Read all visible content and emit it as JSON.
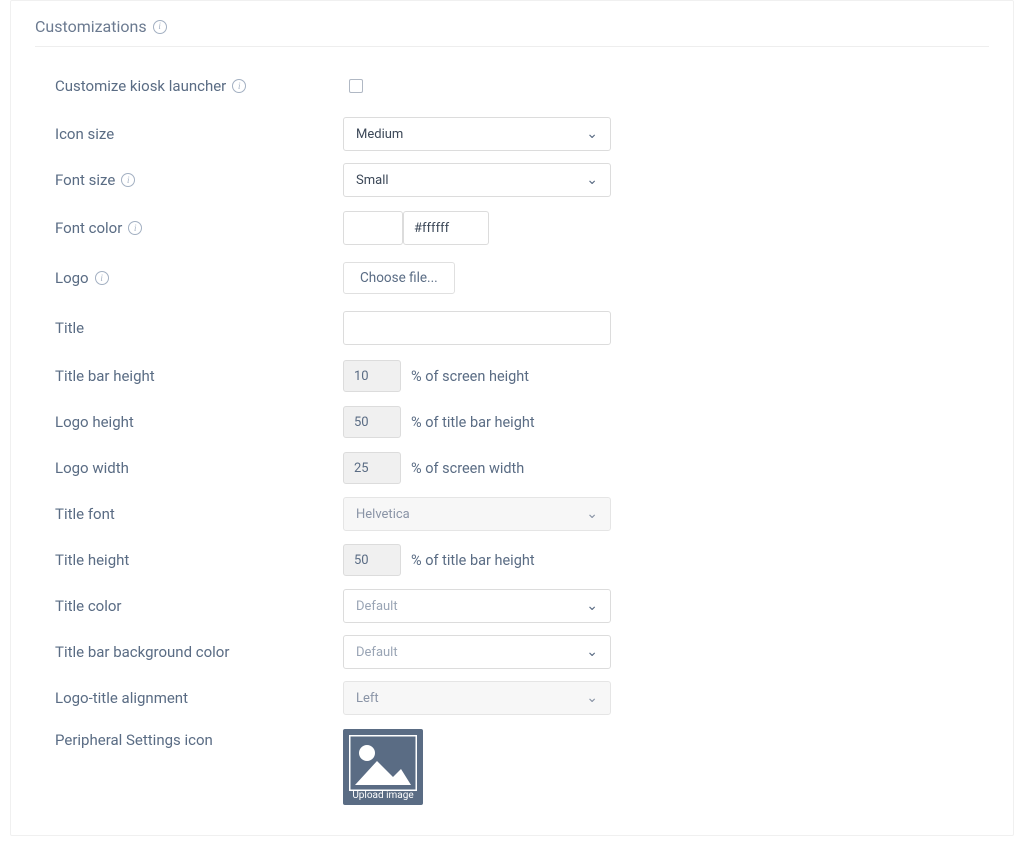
{
  "section": {
    "title": "Customizations"
  },
  "labels": {
    "customize_kiosk": "Customize kiosk launcher",
    "icon_size": "Icon size",
    "font_size": "Font size",
    "font_color": "Font color",
    "logo": "Logo",
    "title": "Title",
    "title_bar_height": "Title bar height",
    "logo_height": "Logo height",
    "logo_width": "Logo width",
    "title_font": "Title font",
    "title_height": "Title height",
    "title_color": "Title color",
    "title_bar_bg": "Title bar background color",
    "logo_title_align": "Logo-title alignment",
    "peripheral_icon": "Peripheral Settings icon"
  },
  "values": {
    "icon_size": "Medium",
    "font_size": "Small",
    "font_color_hex": "#ffffff",
    "choose_file": "Choose file...",
    "title": "",
    "title_bar_height": "10",
    "logo_height": "50",
    "logo_width": "25",
    "title_font": "Helvetica",
    "title_height": "50",
    "title_color": "Default",
    "title_bar_bg": "Default",
    "logo_title_align": "Left",
    "upload_image": "Upload image"
  },
  "suffixes": {
    "pct_screen_height": "% of screen height",
    "pct_titlebar_height": "% of title bar height",
    "pct_screen_width": "% of screen width"
  }
}
